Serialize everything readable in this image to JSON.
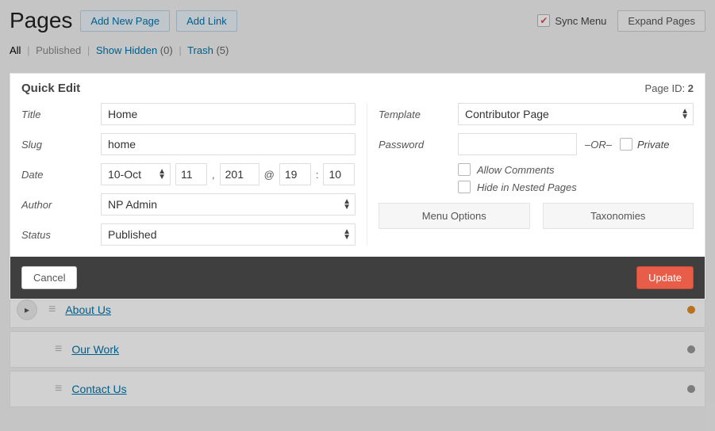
{
  "header": {
    "title": "Pages",
    "add_page": "Add New Page",
    "add_link": "Add Link",
    "sync_menu": "Sync Menu",
    "expand": "Expand Pages"
  },
  "filters": {
    "all": "All",
    "published": "Published",
    "show_hidden": "Show Hidden",
    "show_hidden_count": "(0)",
    "trash": "Trash",
    "trash_count": "(5)"
  },
  "quickedit": {
    "heading": "Quick Edit",
    "page_id_label": "Page ID:",
    "page_id": "2",
    "labels": {
      "title": "Title",
      "slug": "Slug",
      "date": "Date",
      "author": "Author",
      "status": "Status",
      "template": "Template",
      "password": "Password"
    },
    "values": {
      "title": "Home",
      "slug": "home",
      "month": "10-Oct",
      "day": "11",
      "year": "201",
      "hour": "19",
      "minute": "10",
      "author": "NP Admin",
      "status": "Published",
      "template": "Contributor Page",
      "password": ""
    },
    "or_text": "–OR–",
    "private_label": "Private",
    "allow_comments": "Allow Comments",
    "hide_in_nested": "Hide in Nested Pages",
    "menu_options": "Menu Options",
    "taxonomies": "Taxonomies",
    "date_at": ",",
    "date_amp": "@",
    "date_colon": ":"
  },
  "footer": {
    "cancel": "Cancel",
    "update": "Update"
  },
  "pages": [
    {
      "title": "About Us",
      "expandable": true,
      "indent": false,
      "dot": "orange"
    },
    {
      "title": "Our Work",
      "expandable": false,
      "indent": true,
      "dot": "grey"
    },
    {
      "title": "Contact Us",
      "expandable": false,
      "indent": true,
      "dot": "grey"
    }
  ]
}
